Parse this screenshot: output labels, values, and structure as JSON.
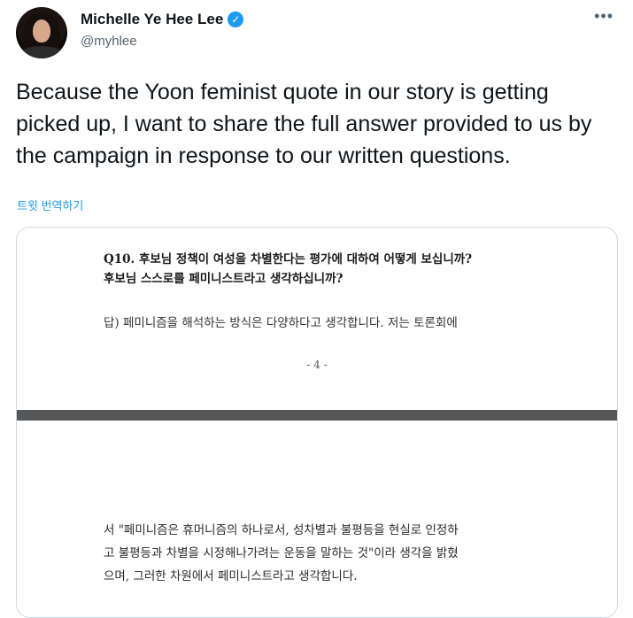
{
  "tweet": {
    "display_name": "Michelle Ye Hee Lee",
    "handle": "@myhlee",
    "text": "Because the Yoon feminist quote in our story is getting picked up, I want to share the full answer provided to us by the campaign in response to our written questions.",
    "translate_label": "트윗 번역하기",
    "more_icon": "•••",
    "verified_icon": "✓"
  },
  "document": {
    "question_line1": "Q10. 후보님 정책이 여성을 차별한다는 평가에 대하여 어떻게 보십니까?",
    "question_line2": "후보님 스스로를 페미니스트라고 생각하십니까?",
    "answer_start": "답) 페미니즘을 해석하는 방식은 다양하다고 생각합니다. 저는 토론회에",
    "page_number": "- 4 -",
    "continuation_line1": "서 \"페미니즘은 휴머니즘의 하나로서, 성차별과 불평등을 현실로 인정하",
    "continuation_line2": "고 불평등과 차별을 시정해나가려는 운동을 말하는 것\"이라 생각을 밝혔",
    "continuation_line3": "으며, 그러한 차원에서 페미니스트라고 생각합니다."
  }
}
